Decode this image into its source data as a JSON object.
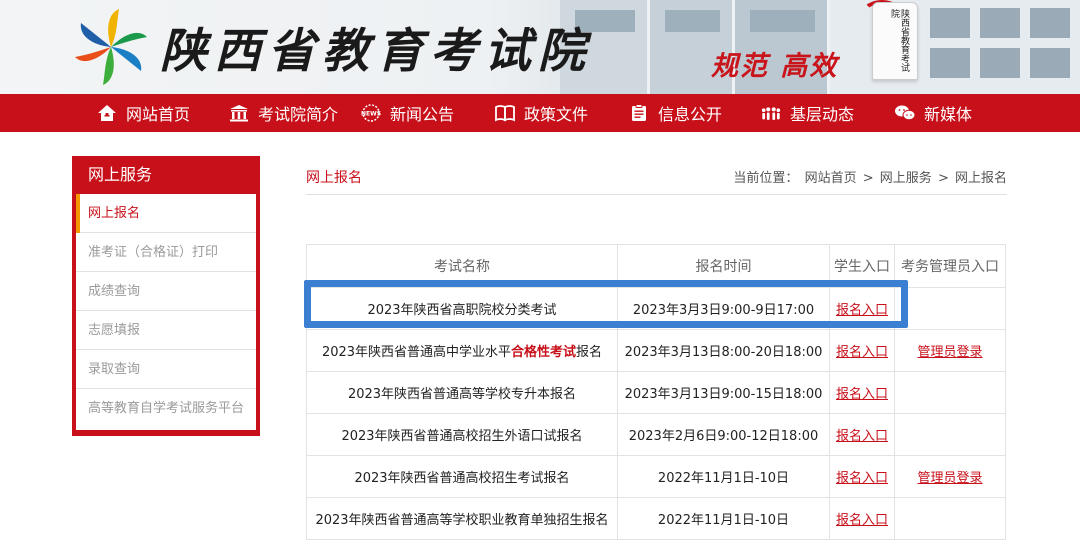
{
  "header": {
    "site_name": "陕西省教育考试院",
    "slogan": "规范 高效",
    "seal_text": "陕西省教育考试院"
  },
  "nav": {
    "items": [
      {
        "label": "网站首页",
        "icon": "home-icon"
      },
      {
        "label": "考试院简介",
        "icon": "building-icon"
      },
      {
        "label": "新闻公告",
        "icon": "news-icon"
      },
      {
        "label": "政策文件",
        "icon": "book-icon"
      },
      {
        "label": "信息公开",
        "icon": "document-icon"
      },
      {
        "label": "基层动态",
        "icon": "people-icon"
      },
      {
        "label": "新媒体",
        "icon": "chat-icon"
      }
    ]
  },
  "sidebar": {
    "title": "网上服务",
    "items": [
      {
        "label": "网上报名",
        "active": true
      },
      {
        "label": "准考证（合格证）打印"
      },
      {
        "label": "成绩查询"
      },
      {
        "label": "志愿填报"
      },
      {
        "label": "录取查询"
      },
      {
        "label": "高等教育自学考试服务平台"
      }
    ]
  },
  "main": {
    "title": "网上报名",
    "breadcrumb": {
      "prefix": "当前位置：",
      "items": [
        "网站首页",
        "网上服务",
        "网上报名"
      ],
      "separator": ">"
    }
  },
  "table": {
    "headers": [
      "考试名称",
      "报名时间",
      "学生入口",
      "考务管理员入口"
    ],
    "rows": [
      {
        "name": "2023年陕西省高职院校分类考试",
        "time": "2023年3月3日9:00-9日17:00",
        "student": "报名入口",
        "admin": ""
      },
      {
        "name_pre": "2023年陕西省普通高中学业水平",
        "name_hl": "合格性考试",
        "name_post": "报名",
        "time": "2023年3月13日8:00-20日18:00",
        "student": "报名入口",
        "admin": "管理员登录"
      },
      {
        "name": "2023年陕西省普通高等学校专升本报名",
        "time": "2023年3月13日9:00-15日18:00",
        "student": "报名入口",
        "admin": ""
      },
      {
        "name": "2023年陕西省普通高校招生外语口试报名",
        "time": "2023年2月6日9:00-12日18:00",
        "student": "报名入口",
        "admin": ""
      },
      {
        "name": "2023年陕西省普通高校招生考试报名",
        "time": "2022年11月1日-10日",
        "student": "报名入口",
        "admin": "管理员登录"
      },
      {
        "name": "2023年陕西省普通高等学校职业教育单独招生报名",
        "time": "2022年11月1日-10日",
        "student": "报名入口",
        "admin": ""
      }
    ]
  },
  "colors": {
    "brand_red": "#c8101a",
    "active_marker": "#f39800",
    "highlight_blue": "#3a7fd1"
  }
}
